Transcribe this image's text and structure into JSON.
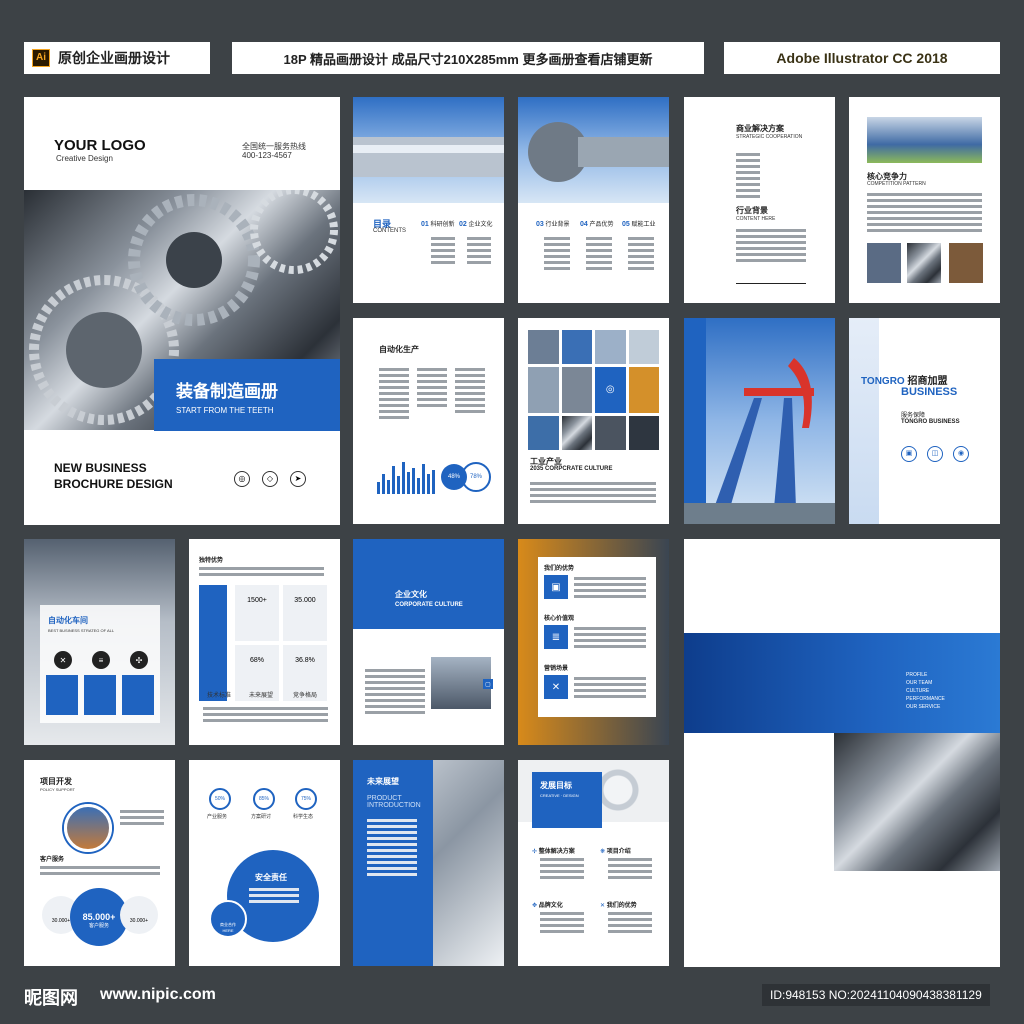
{
  "header": {
    "ai_badge": "Ai",
    "left_title": "原创企业画册设计",
    "center_title": "18P 精品画册设计 成品尺寸210X285mm 更多画册查看店铺更新",
    "right_title": "Adobe Illustrator CC 2018"
  },
  "cover": {
    "logo": "YOUR LOGO",
    "logo_sub": "Creative Design",
    "hotline_label": "全国统一服务热线",
    "hotline": "400-123-4567",
    "title_cn": "装备制造画册",
    "title_en": "START FROM THE TEETH",
    "bottom_line1": "NEW BUSINESS",
    "bottom_line2": "BROCHURE DESIGN"
  },
  "contents": {
    "title": "目录",
    "sub": "CONTENTS",
    "items": [
      {
        "num": "01",
        "label": "科研创新"
      },
      {
        "num": "02",
        "label": "企业文化"
      },
      {
        "num": "03",
        "label": "行业背景"
      },
      {
        "num": "04",
        "label": "产品优势"
      },
      {
        "num": "05",
        "label": "赋能工业"
      }
    ]
  },
  "p4": {
    "t1": "商业解决方案",
    "s1": "STRATEGIC COOPERATION",
    "t2": "行业背景",
    "s2": "CONTENT HERE"
  },
  "p5": {
    "t1": "核心竞争力",
    "s1": "COMPETITION PATTERN"
  },
  "p6": {
    "title": "自动化生产",
    "pct1": "48%",
    "pct2": "78%"
  },
  "p7": {
    "t1": "工业产业",
    "s1": "2035 CORPCRATE CULTURE"
  },
  "p9": {
    "t1": "TONGRO",
    "t2": "招商加盟",
    "t3": "BUSINESS",
    "t4": "服务保障",
    "t5": "TONGRO BUSINESS"
  },
  "p10": {
    "title": "自动化车间",
    "sub": "BEST BUSINESS STRATEG OF ALL"
  },
  "p11": {
    "title": "独特优势",
    "v1": "1500+",
    "v2": "35.000",
    "v3": "68%",
    "v4": "36.8%",
    "l1": "技术标准",
    "l2": "未来展望",
    "l3": "竞争格局"
  },
  "p12": {
    "title": "企业文化",
    "sub": "CORPORATE CULTURE"
  },
  "p13": {
    "t1": "我们的优势",
    "t2": "核心价值观",
    "t3": "营销场景"
  },
  "p15": {
    "items": [
      "PROFILE",
      "OUR TEAM",
      "CULTURE",
      "PERFORMANCE",
      "OUR SERVICE"
    ]
  },
  "p16": {
    "title": "项目开发",
    "sub": "POLICY SUPPORT",
    "label": "客户服务",
    "num": "85.000+",
    "num_label": "客户服务",
    "side1": "30.000+",
    "side2": "30.000+"
  },
  "p17": {
    "c1": "50%",
    "c2": "85%",
    "c3": "75%",
    "l1": "产业服务",
    "l2": "方案研讨",
    "l3": "科学生态",
    "title": "安全责任",
    "small": "商业合作",
    "small2": "HERE"
  },
  "p18": {
    "title": "未来展望",
    "sub1": "PRODUCT",
    "sub2": "INTRODUCTION"
  },
  "p19": {
    "title": "发展目标",
    "sub": "CREATIVE · DESIGN",
    "i1": "整体解决方案",
    "i2": "项目介绍",
    "i3": "品牌文化",
    "i4": "我们的优势"
  },
  "footer": {
    "logo": "昵图网",
    "url": "www.nipic.com",
    "id": "ID:948153 NO:20241104090438381129"
  }
}
